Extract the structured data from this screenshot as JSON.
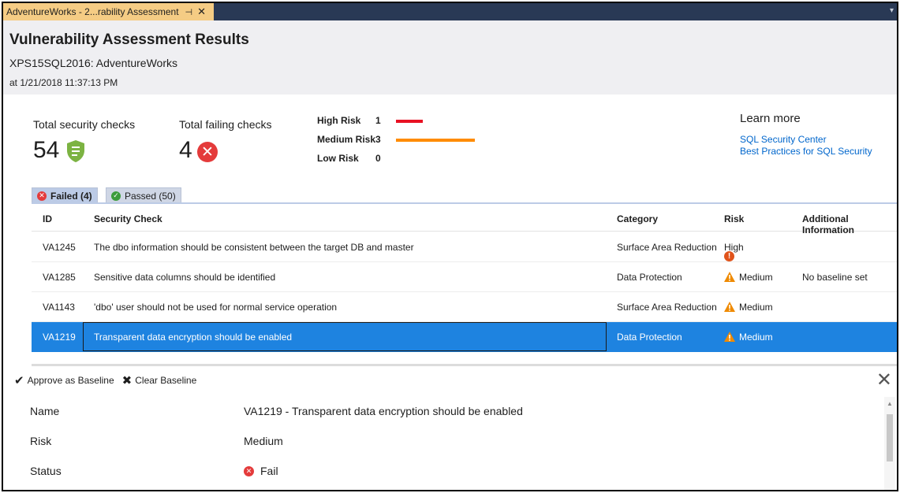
{
  "tab": {
    "title": "AdventureWorks - 2...rability Assessment",
    "pin": "⊣",
    "close": "✕"
  },
  "header": {
    "title": "Vulnerability Assessment Results",
    "server_db": "XPS15SQL2016: AdventureWorks",
    "timestamp": "at 1/21/2018 11:37:13 PM"
  },
  "summary": {
    "total_checks_label": "Total security checks",
    "total_checks_value": "54",
    "failing_checks_label": "Total failing checks",
    "failing_checks_value": "4",
    "risks": [
      {
        "label": "High Risk",
        "count": "1",
        "color": "#e81123"
      },
      {
        "label": "Medium Risk",
        "count": "3",
        "color": "#ff8c00"
      },
      {
        "label": "Low Risk",
        "count": "0",
        "color": "#ffffff"
      }
    ]
  },
  "learn_more": {
    "title": "Learn more",
    "links": [
      "SQL Security Center",
      "Best Practices for SQL Security"
    ]
  },
  "filter_tabs": {
    "failed": "Failed (4)",
    "passed": "Passed (50)"
  },
  "table": {
    "columns": [
      "ID",
      "Security Check",
      "Category",
      "Risk",
      "Additional Information"
    ],
    "rows": [
      {
        "id": "VA1245",
        "check": "The dbo information should be consistent between the target DB and master",
        "category": "Surface Area Reduction",
        "risk": "High",
        "info": ""
      },
      {
        "id": "VA1285",
        "check": "Sensitive data columns should be identified",
        "category": "Data Protection",
        "risk": "Medium",
        "info": "No baseline set"
      },
      {
        "id": "VA1143",
        "check": "'dbo' user should not be used for normal service operation",
        "category": "Surface Area Reduction",
        "risk": "Medium",
        "info": ""
      },
      {
        "id": "VA1219",
        "check": "Transparent data encryption should be enabled",
        "category": "Data Protection",
        "risk": "Medium",
        "info": ""
      }
    ]
  },
  "details": {
    "approve_label": "Approve as Baseline",
    "clear_label": "Clear Baseline",
    "close": "✕",
    "fields": [
      {
        "label": "Name",
        "value": "VA1219 - Transparent data encryption should be enabled"
      },
      {
        "label": "Risk",
        "value": "Medium"
      },
      {
        "label": "Status",
        "value": "Fail"
      }
    ]
  }
}
